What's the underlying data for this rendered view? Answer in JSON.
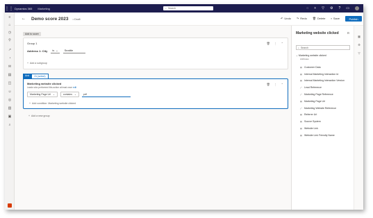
{
  "topbar": {
    "brand": "Dynamics 365",
    "app": "Marketing",
    "search_placeholder": "Search"
  },
  "command": {
    "title": "Demo score 2023",
    "status": "Draft",
    "actions": [
      "Undo",
      "Redo",
      "Delete",
      "Save"
    ],
    "publish": "Publish"
  },
  "builder": {
    "all_tag": "Add to score",
    "group1": {
      "title": "Group 1",
      "attribute": "Address 1: City",
      "operator": "is",
      "value": "Seattle",
      "add_subgroup": "Add a subgroup"
    },
    "operator_tabs": [
      "And",
      "Or (select)"
    ],
    "group2": {
      "title": "Marketing website clicked",
      "subtitle_prefix": "Leads who performed this action at least once ",
      "subtitle_link": "edit",
      "field": "Marketing Page Url",
      "operator": "contains",
      "value": "pdf",
      "add_condition": "Add condition: Marketing website clicked"
    },
    "add_group": "Add a new group"
  },
  "panel": {
    "title": "Marketing website clicked",
    "search_placeholder": "Search",
    "node": "Marketing website clicked",
    "node_sub": "Attributes",
    "items": [
      "Customer Data",
      "Internal Marketing Interaction Id",
      "Internal Marketing Interaction Version",
      "Lead Reference",
      "Marketing Page Reference",
      "Marketing Page Url",
      "Marketing Website Reference",
      "Referrer Url",
      "Source System",
      "Website Link",
      "Website Link Friendly Name"
    ]
  }
}
